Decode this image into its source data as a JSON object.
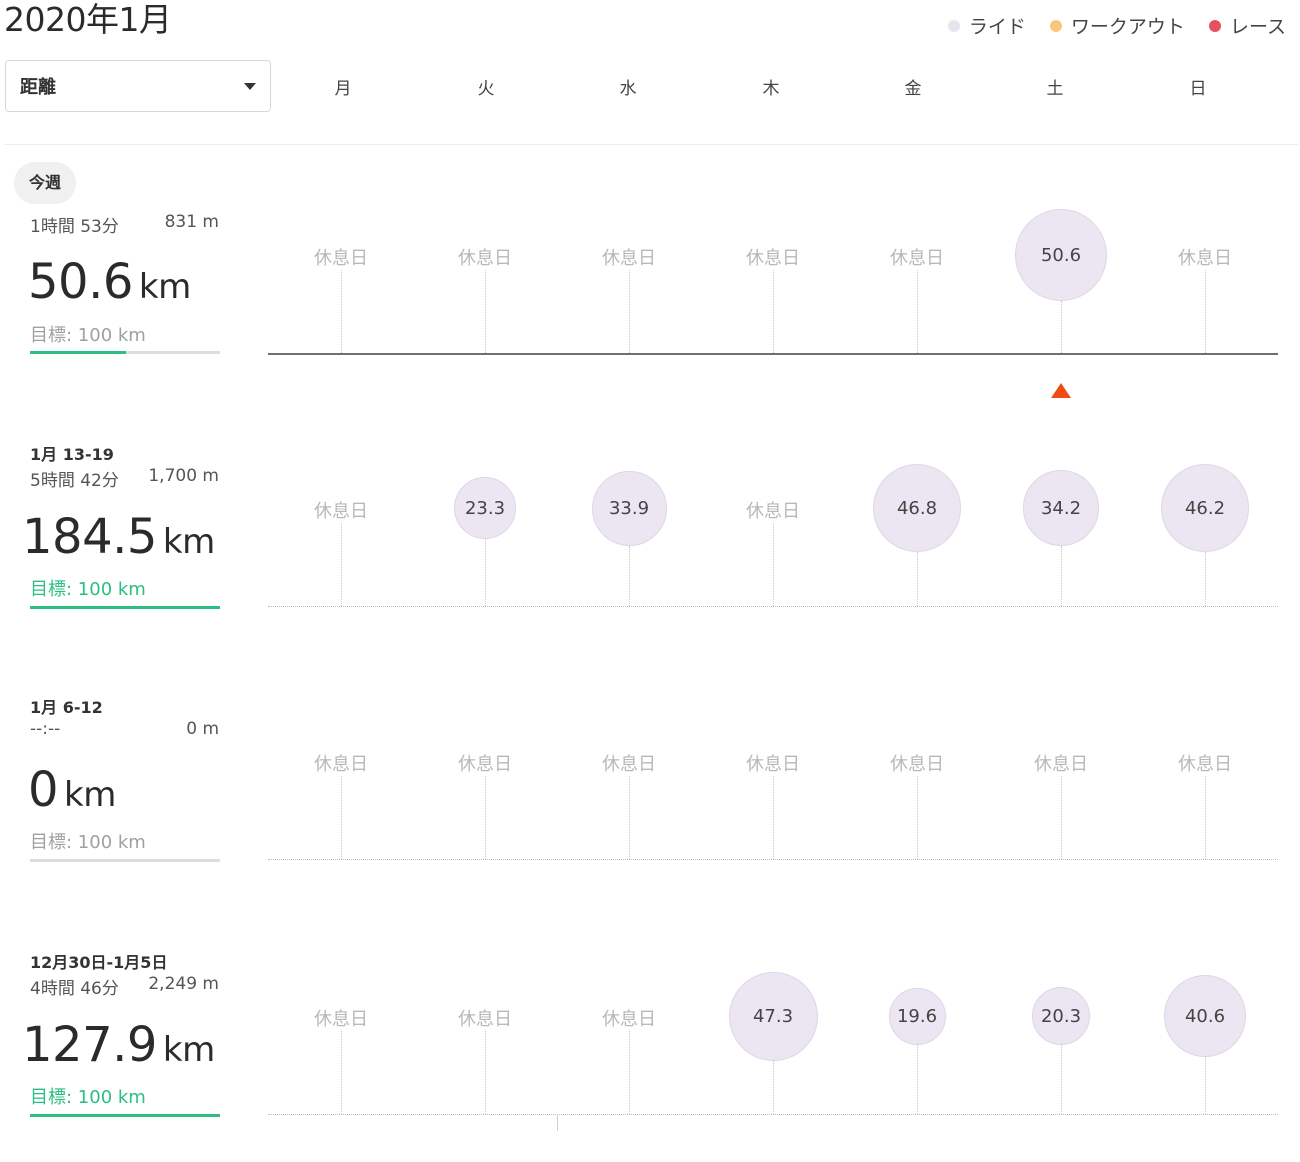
{
  "title": "2020年1月",
  "legend": [
    {
      "label": "ライド",
      "color": "#e8e4ef"
    },
    {
      "label": "ワークアウト",
      "color": "#f8c77b"
    },
    {
      "label": "レース",
      "color": "#e3525d"
    }
  ],
  "metric_select": {
    "value": "距離"
  },
  "days": [
    "月",
    "火",
    "水",
    "木",
    "金",
    "土",
    "日"
  ],
  "rest_label": "休息日",
  "current_badge": "今週",
  "weeks": [
    {
      "label": "",
      "time": "1時間 53分",
      "elevation": "831 m",
      "distance": "50.6",
      "unit": "km",
      "goal": "目標: 100 km",
      "goal_progress": 0.506,
      "goal_met": false,
      "current": true,
      "rides": [
        null,
        null,
        null,
        null,
        null,
        "50.6",
        null
      ],
      "ride_values": [
        0,
        0,
        0,
        0,
        0,
        50.6,
        0
      ]
    },
    {
      "label": "1月 13-19",
      "time": "5時間 42分",
      "elevation": "1,700 m",
      "distance": "184.5",
      "unit": "km",
      "goal": "目標: 100 km",
      "goal_progress": 1.0,
      "goal_met": true,
      "current": false,
      "rides": [
        null,
        "23.3",
        "33.9",
        null,
        "46.8",
        "34.2",
        "46.2"
      ],
      "ride_values": [
        0,
        23.3,
        33.9,
        0,
        46.8,
        34.2,
        46.2
      ]
    },
    {
      "label": "1月 6-12",
      "time": "--:--",
      "elevation": "0 m",
      "distance": "0",
      "unit": "km",
      "goal": "目標: 100 km",
      "goal_progress": 0,
      "goal_met": false,
      "current": false,
      "rides": [
        null,
        null,
        null,
        null,
        null,
        null,
        null
      ],
      "ride_values": [
        0,
        0,
        0,
        0,
        0,
        0,
        0
      ]
    },
    {
      "label": "12月30日-1月5日",
      "time": "4時間 46分",
      "elevation": "2,249 m",
      "distance": "127.9",
      "unit": "km",
      "goal": "目標: 100 km",
      "goal_progress": 1.0,
      "goal_met": true,
      "current": false,
      "rides": [
        null,
        null,
        null,
        "47.3",
        "19.6",
        "20.3",
        "40.6"
      ],
      "ride_values": [
        0,
        0,
        0,
        47.3,
        19.6,
        20.3,
        40.6
      ]
    }
  ]
}
